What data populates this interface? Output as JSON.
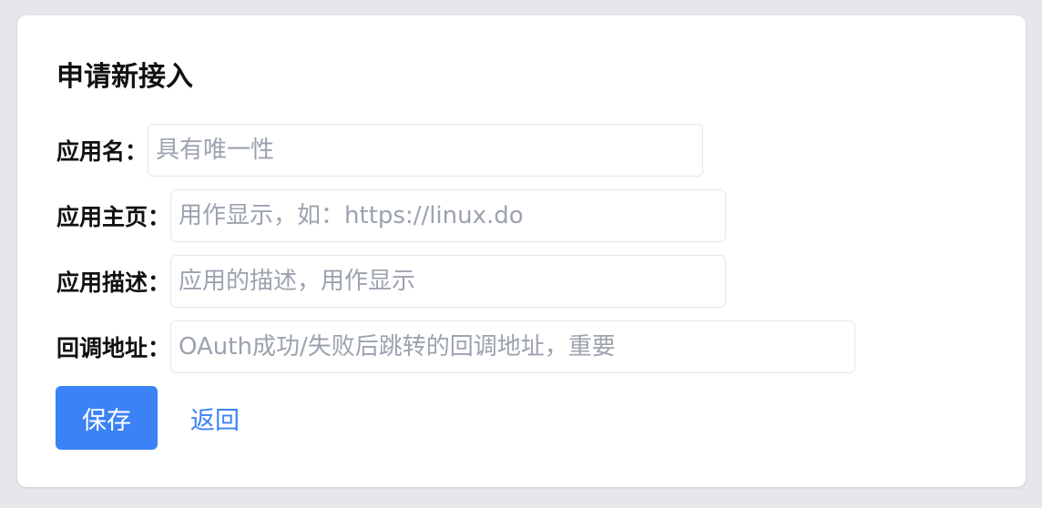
{
  "form": {
    "title": "申请新接入",
    "fields": [
      {
        "label": "应用名：",
        "placeholder": "具有唯一性",
        "value": ""
      },
      {
        "label": "应用主页：",
        "placeholder": "用作显示，如：https://linux.do",
        "value": ""
      },
      {
        "label": "应用描述：",
        "placeholder": "应用的描述，用作显示",
        "value": ""
      },
      {
        "label": "回调地址：",
        "placeholder": "OAuth成功/失败后跳转的回调地址，重要",
        "value": ""
      }
    ],
    "save_label": "保存",
    "back_label": "返回"
  },
  "colors": {
    "background": "#e5e7eb",
    "card": "#ffffff",
    "accent": "#3b82f6",
    "placeholder": "#9ca3af"
  }
}
